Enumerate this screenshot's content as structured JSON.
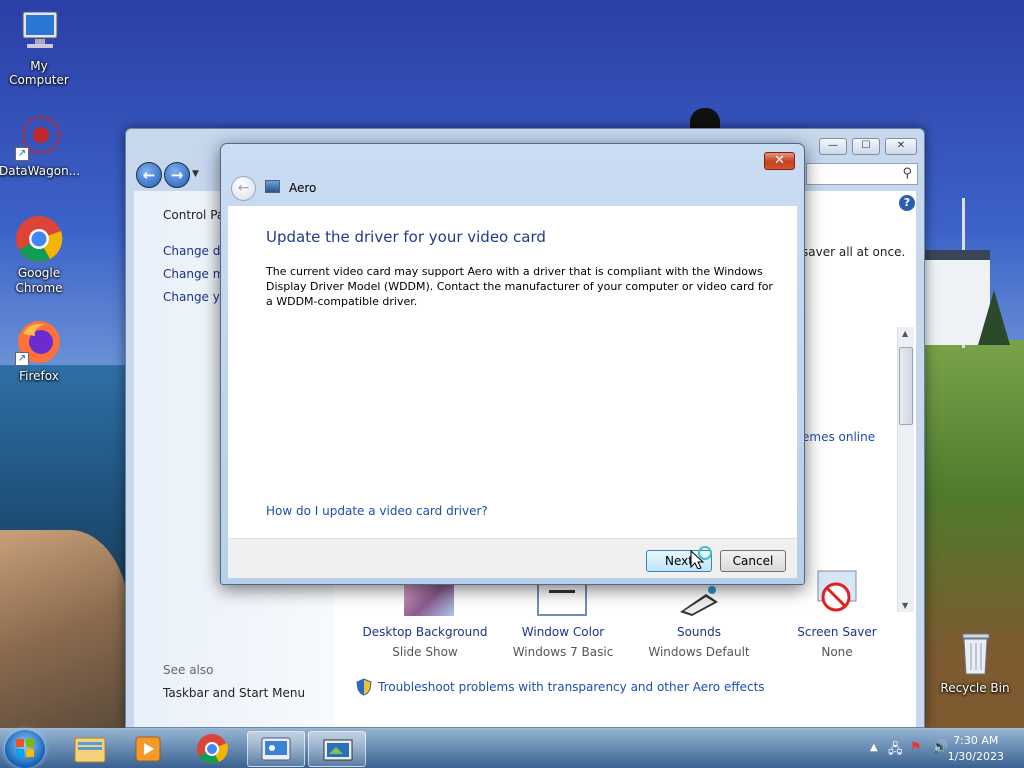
{
  "desktop": {
    "icons": [
      {
        "label": "My Computer"
      },
      {
        "label": "DataWagon..."
      },
      {
        "label": "Google Chrome"
      },
      {
        "label": "Firefox"
      },
      {
        "label": "Recycle Bin"
      }
    ]
  },
  "control_panel": {
    "breadcrumb": "Control Pa",
    "sidebar_links": [
      "Change de",
      "Change m",
      "Change yo"
    ],
    "see_also_title": "See also",
    "see_also_link": "Taskbar and Start Menu",
    "partial_desc": "saver all at once.",
    "themes_online_link": "emes online",
    "items": [
      {
        "label": "Desktop Background",
        "sub": "Slide Show"
      },
      {
        "label": "Window Color",
        "sub": "Windows 7 Basic"
      },
      {
        "label": "Sounds",
        "sub": "Windows Default"
      },
      {
        "label": "Screen Saver",
        "sub": "None"
      }
    ],
    "troubleshoot_link": "Troubleshoot problems with transparency and other Aero effects"
  },
  "dialog": {
    "title": "Aero",
    "heading": "Update the driver for your video card",
    "body": "The current video card may support Aero with a driver that is compliant with the Windows Display Driver Model (WDDM).  Contact the manufacturer of your computer or video card for a WDDM-compatible driver.",
    "help_link": "How do I update a video card driver?",
    "next_button": "Next",
    "cancel_button": "Cancel",
    "close_glyph": "✕"
  },
  "taskbar": {
    "time": "7:30 AM",
    "date": "1/30/2023"
  }
}
